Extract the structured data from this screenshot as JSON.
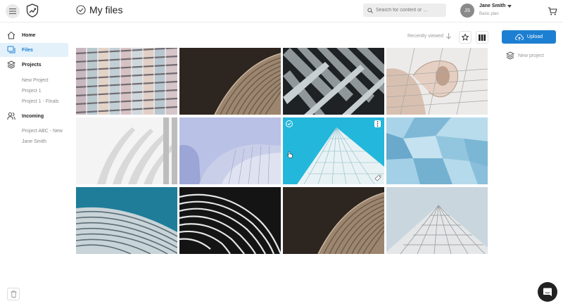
{
  "header": {
    "title": "My files",
    "search_placeholder": "Search for content or ...",
    "user": {
      "initials": "JS",
      "name": "Jane Smith",
      "plan": "Basic plan"
    }
  },
  "sidebar": {
    "items": [
      {
        "label": "Home",
        "icon": "home-icon",
        "active": false
      },
      {
        "label": "Files",
        "icon": "files-icon",
        "active": true
      },
      {
        "label": "Projects",
        "icon": "layers-icon",
        "active": false
      }
    ],
    "projects": [
      "New Project",
      "Project 1",
      "Project 1 - Finals"
    ],
    "incoming_label": "Incoming",
    "incoming": [
      "Project ABC - New",
      "Jane Smith"
    ]
  },
  "toolbar": {
    "sort_label": "Recently viewed",
    "upload_label": "Upload",
    "new_project_label": "New project"
  },
  "colors": {
    "accent": "#1d7fd1",
    "active_bg": "#e3f1fb"
  }
}
